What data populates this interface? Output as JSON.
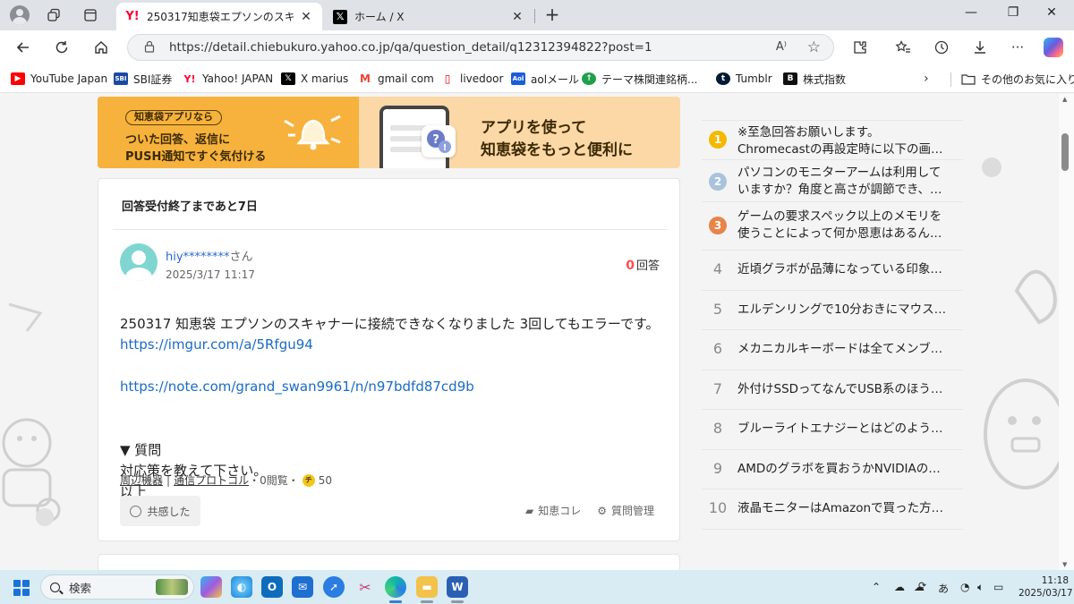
{
  "browser": {
    "tabs": [
      {
        "favicon": "Y!",
        "title": "250317知恵袋エプソンのスキャナーに接続できなくなりました",
        "active": true
      },
      {
        "favicon": "𝕏",
        "title": "ホーム / X",
        "active": false
      }
    ],
    "url": "https://detail.chiebukuro.yahoo.co.jp/qa/question_detail/q12312394822?post=1",
    "read_aloud_icon": "A⁾",
    "bookmarks": [
      {
        "label": "YouTube Japan",
        "icon": "▶",
        "color": "#ff0000"
      },
      {
        "label": "SBI証券",
        "icon": "SBI",
        "color": "#1b4aa3"
      },
      {
        "label": "Yahoo! JAPAN",
        "icon": "Y!",
        "color": "#ff0033"
      },
      {
        "label": "X marius",
        "icon": "𝕏",
        "color": "#000000"
      },
      {
        "label": "gmail com",
        "icon": "M",
        "color": "#ea4335"
      },
      {
        "label": "livedoor",
        "icon": "▯",
        "color": "#e60012"
      },
      {
        "label": "aolメール",
        "icon": "Aol",
        "color": "#1a5ed8"
      },
      {
        "label": "テーマ株",
        "icon": "↑",
        "color": "#21a04b"
      },
      {
        "label": "関連銘柄...",
        "icon": "",
        "color": "#ffffff"
      },
      {
        "label": "Tumblr",
        "icon": "t",
        "color": "#001935"
      },
      {
        "label": "株式指数",
        "icon": "B",
        "color": "#111111"
      }
    ],
    "other_favorites": "その他のお気に入り"
  },
  "banner": {
    "pill": "知恵袋アプリなら",
    "line1": "ついた回答、返信に",
    "line2": "PUSH通知ですぐ気付ける",
    "right1": "アプリを使って",
    "right2": "知恵袋をもっと便利に"
  },
  "question": {
    "deadline": "回答受付終了まであと7日",
    "user": "hiy********",
    "user_suffix": "さん",
    "date": "2025/3/17 11:17",
    "answer_count": "0",
    "answer_label": "回答",
    "body_line1": "250317 知恵袋 エプソンのスキャナーに接続できなくなりました 3回してもエラーです。",
    "link1": "https://imgur.com/a/5Rfgu94",
    "link2": "https://note.com/grand_swan9961/n/n97bdfd87cd9b",
    "body_rest": "▼ 質問\n対応策を教えて下さい。\n以上",
    "tag1": "周辺機器",
    "tag_sep": "|",
    "tag2": "通信プロトコル",
    "views": "・0閲覧・",
    "coin_label": "チ",
    "coins": "50",
    "empathy": "共感した",
    "chiekore": "知恵コレ",
    "manage": "質問管理"
  },
  "ranking": [
    {
      "rank": "1",
      "color": "#f5b800",
      "lines": [
        "※至急回答お願いします。",
        "Chromecastの再設定時に以下の画…"
      ]
    },
    {
      "rank": "2",
      "color": "#a9c3dc",
      "lines": [
        "パソコンのモニターアームは利用して",
        "いますか？角度と高さが調節でき、…"
      ]
    },
    {
      "rank": "3",
      "color": "#e8844a",
      "lines": [
        "ゲームの要求スペック以上のメモリを",
        "使うことによって何か恩恵はあるん…"
      ]
    },
    {
      "rank": "4",
      "lines": [
        "近頃グラボが品薄になっている印象…"
      ]
    },
    {
      "rank": "5",
      "lines": [
        "エルデンリングで10分おきにマウス…"
      ]
    },
    {
      "rank": "6",
      "lines": [
        "メカニカルキーボードは全てメンブ…"
      ]
    },
    {
      "rank": "7",
      "lines": [
        "外付けSSDってなんでUSB系のほう…"
      ]
    },
    {
      "rank": "8",
      "lines": [
        "ブルーライトエナジーとはどのよう…"
      ]
    },
    {
      "rank": "9",
      "lines": [
        "AMDのグラボを買おうかNVIDIAの…"
      ]
    },
    {
      "rank": "10",
      "lines": [
        "液晶モニターはAmazonで買った方…"
      ]
    }
  ],
  "taskbar": {
    "search_placeholder": "検索",
    "ime": "あ",
    "time": "11:18",
    "date": "2025/03/17"
  }
}
